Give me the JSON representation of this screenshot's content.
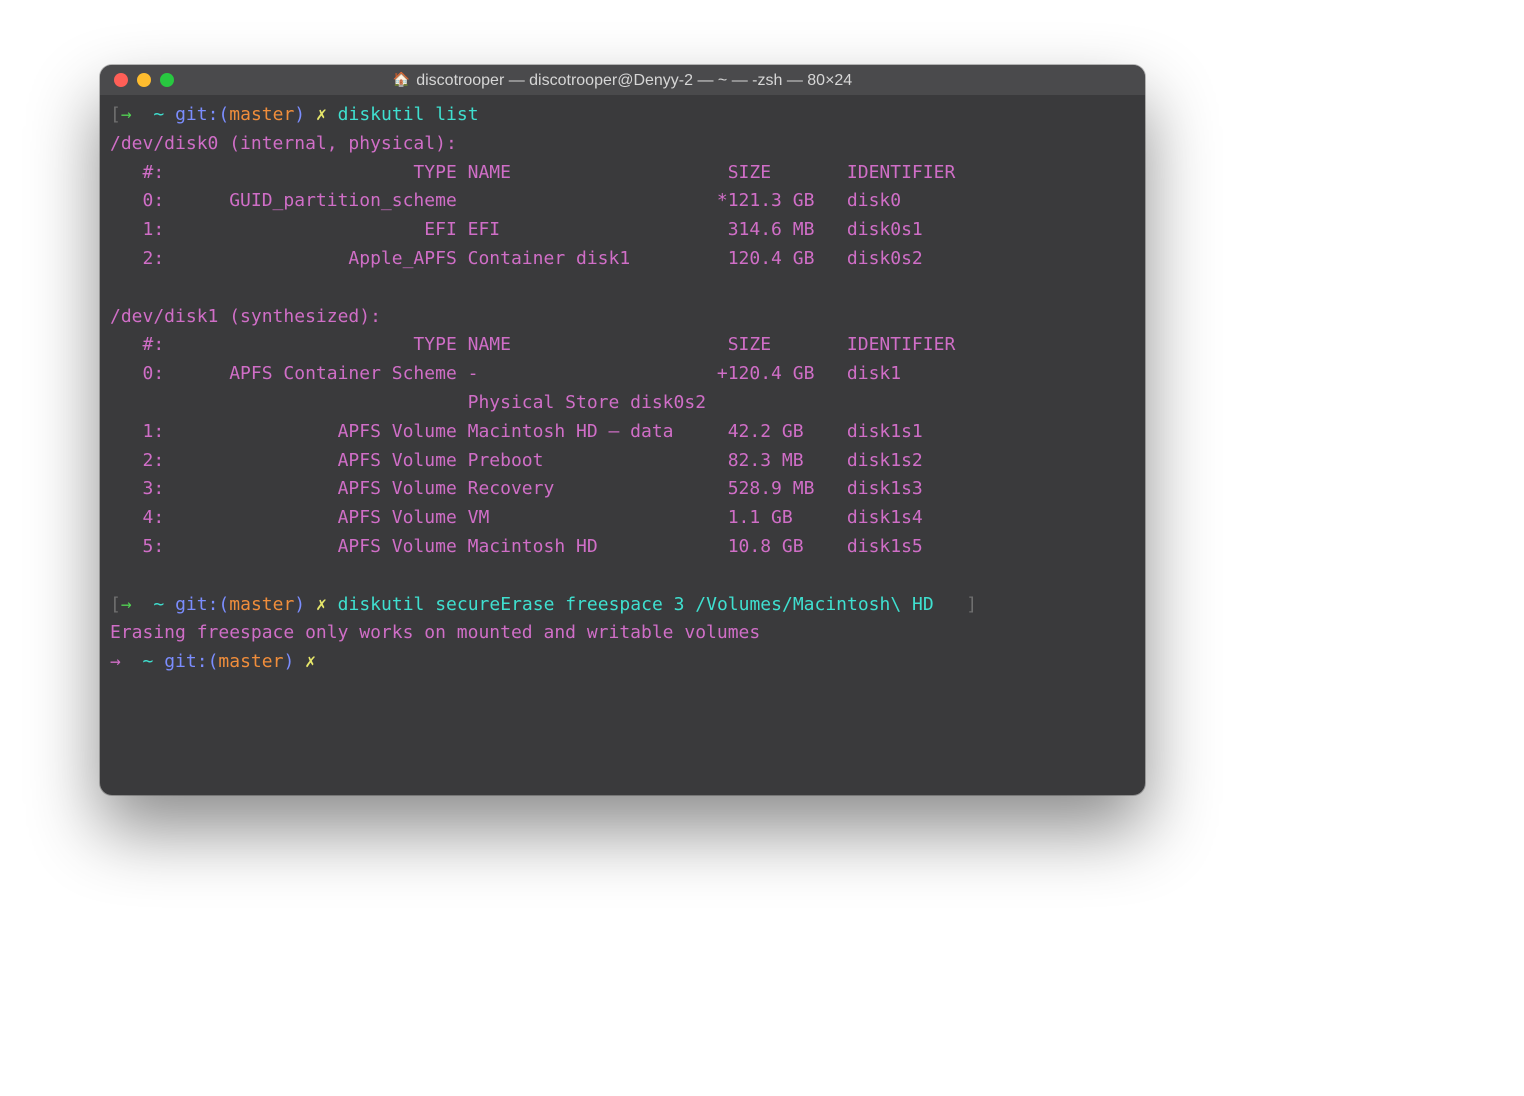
{
  "window": {
    "title": "discotrooper — discotrooper@Denyy-2 — ~ — -zsh — 80×24",
    "house_icon": "🏠"
  },
  "prompt": {
    "lbracket": "[",
    "rbracket": "]",
    "arrow": "→",
    "home": "~",
    "git": "git:",
    "paren_open": "(",
    "branch": "master",
    "paren_close": ")",
    "x": "✗"
  },
  "commands": {
    "cmd1": "diskutil list",
    "cmd2": "diskutil secureErase freespace 3 /Volumes/Macintosh\\ HD"
  },
  "disk0": {
    "header": "/dev/disk0 (internal, physical):",
    "cols": "   #:                       TYPE NAME                    SIZE       IDENTIFIER",
    "r0": "   0:      GUID_partition_scheme                        *121.3 GB   disk0",
    "r1": "   1:                        EFI EFI                     314.6 MB   disk0s1",
    "r2": "   2:                 Apple_APFS Container disk1         120.4 GB   disk0s2"
  },
  "disk1": {
    "header": "/dev/disk1 (synthesized):",
    "cols": "   #:                       TYPE NAME                    SIZE       IDENTIFIER",
    "r0": "   0:      APFS Container Scheme -                      +120.4 GB   disk1",
    "rps": "                                 Physical Store disk0s2",
    "r1": "   1:                APFS Volume Macintosh HD — data     42.2 GB    disk1s1",
    "r2": "   2:                APFS Volume Preboot                 82.3 MB    disk1s2",
    "r3": "   3:                APFS Volume Recovery                528.9 MB   disk1s3",
    "r4": "   4:                APFS Volume VM                      1.1 GB     disk1s4",
    "r5": "   5:                APFS Volume Macintosh HD            10.8 GB    disk1s5"
  },
  "error": "Erasing freespace only works on mounted and writable volumes"
}
